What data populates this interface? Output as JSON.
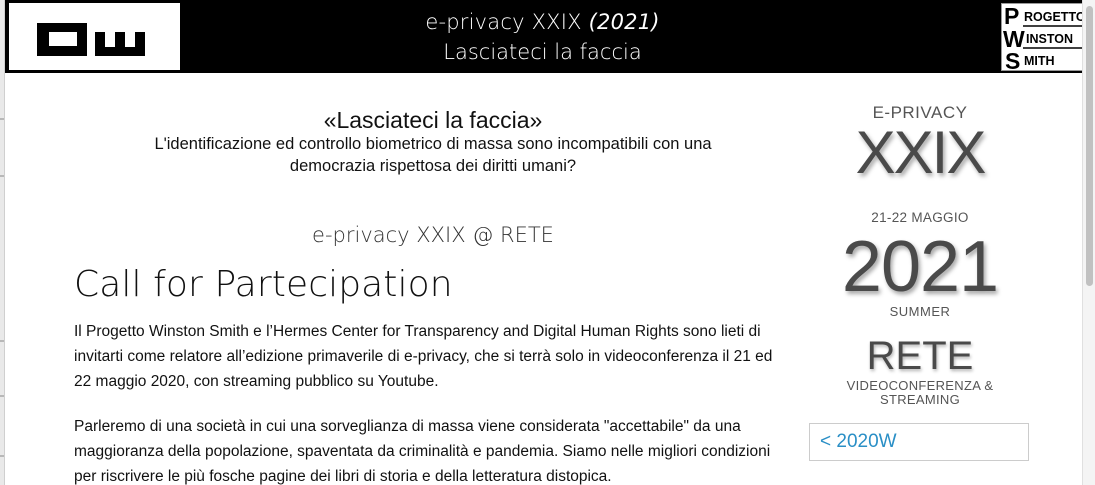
{
  "header": {
    "title_line1_main": "e-privacy XXIX",
    "title_line1_year": "(2021)",
    "title_line2": "Lasciateci la faccia",
    "pws_logo": {
      "line1_initial": "P",
      "line1_rest": "ROGETTO",
      "line2_initial": "W",
      "line2_rest": "INSTON",
      "line3_initial": "S",
      "line3_rest": "MITH"
    }
  },
  "main": {
    "hero_title": "«Lasciateci la faccia»",
    "hero_subtitle_line1": "L'identificazione ed controllo biometrico di massa sono incompatibili con una",
    "hero_subtitle_line2": "democrazia rispettosa dei diritti umani?",
    "section_tag": "e-privacy XXIX @ RETE",
    "cfp_heading": "Call for Partecipation",
    "paragraph1": "Il Progetto Winston Smith e l’Hermes Center for Transparency and Digital Human Rights sono lieti di invitarti come relatore all’edizione primaverile di e-privacy, che si terrà solo in videoconferenza il 21 ed 22 maggio 2020, con streaming pubblico su Youtube.",
    "paragraph2": "Parleremo di una società in cui una sorveglianza di massa viene considerata \"accettabile\" da una maggioranza della popolazione, spaventata da criminalità e pandemia. Siamo nelle migliori condizioni per riscrivere le più fosche pagine dei libri di storia e della letteratura distopica."
  },
  "sidebar": {
    "eprivacy_label": "E-PRIVACY",
    "edition_number": "XXIX",
    "dates": "21-22 MAGGIO",
    "year": "2021",
    "season": "SUMMER",
    "venue": "RETE",
    "venue_sub": "VIDEOCONFERENZA & STREAMING",
    "prev_edition_link": "< 2020W"
  },
  "colors": {
    "header_bg": "#000000",
    "link": "#2a8fc6",
    "sidebar_text": "#4a4a4a"
  }
}
